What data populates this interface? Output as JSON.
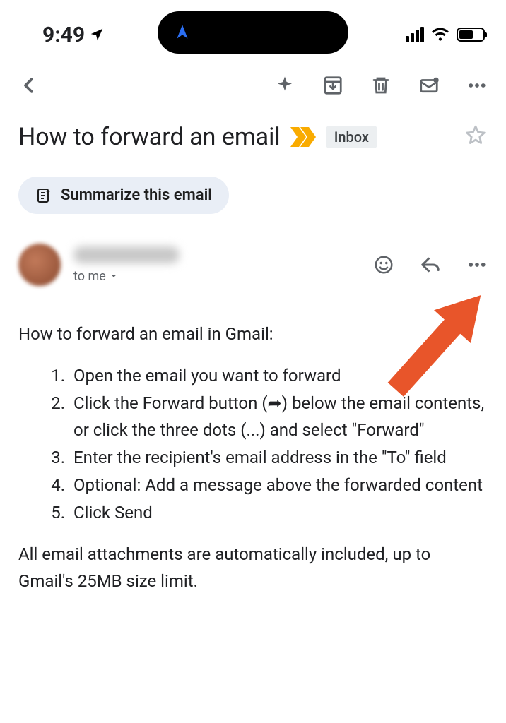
{
  "statusbar": {
    "time": "9:49"
  },
  "toolbar": {},
  "subject": {
    "text": "How to forward an email",
    "label": "Inbox"
  },
  "summarize": {
    "label": "Summarize this email"
  },
  "sender": {
    "to_line": "to me"
  },
  "body": {
    "intro": "How to forward an email in Gmail:",
    "steps": [
      "Open the email you want to forward",
      "Click the Forward button (➦) below the email contents, or click the three dots (...) and select \"Forward\"",
      "Enter the recipient's email address in the \"To\" field",
      "Optional: Add a message above the forwarded content",
      "Click Send"
    ],
    "footer": "All email attachments are automatically included, up to Gmail's 25MB size limit."
  },
  "colors": {
    "accent_orange": "#e8552a",
    "label_yellow": "#f9ab00",
    "chip_bg": "#e9eef6",
    "icon_grey": "#5f6368"
  }
}
